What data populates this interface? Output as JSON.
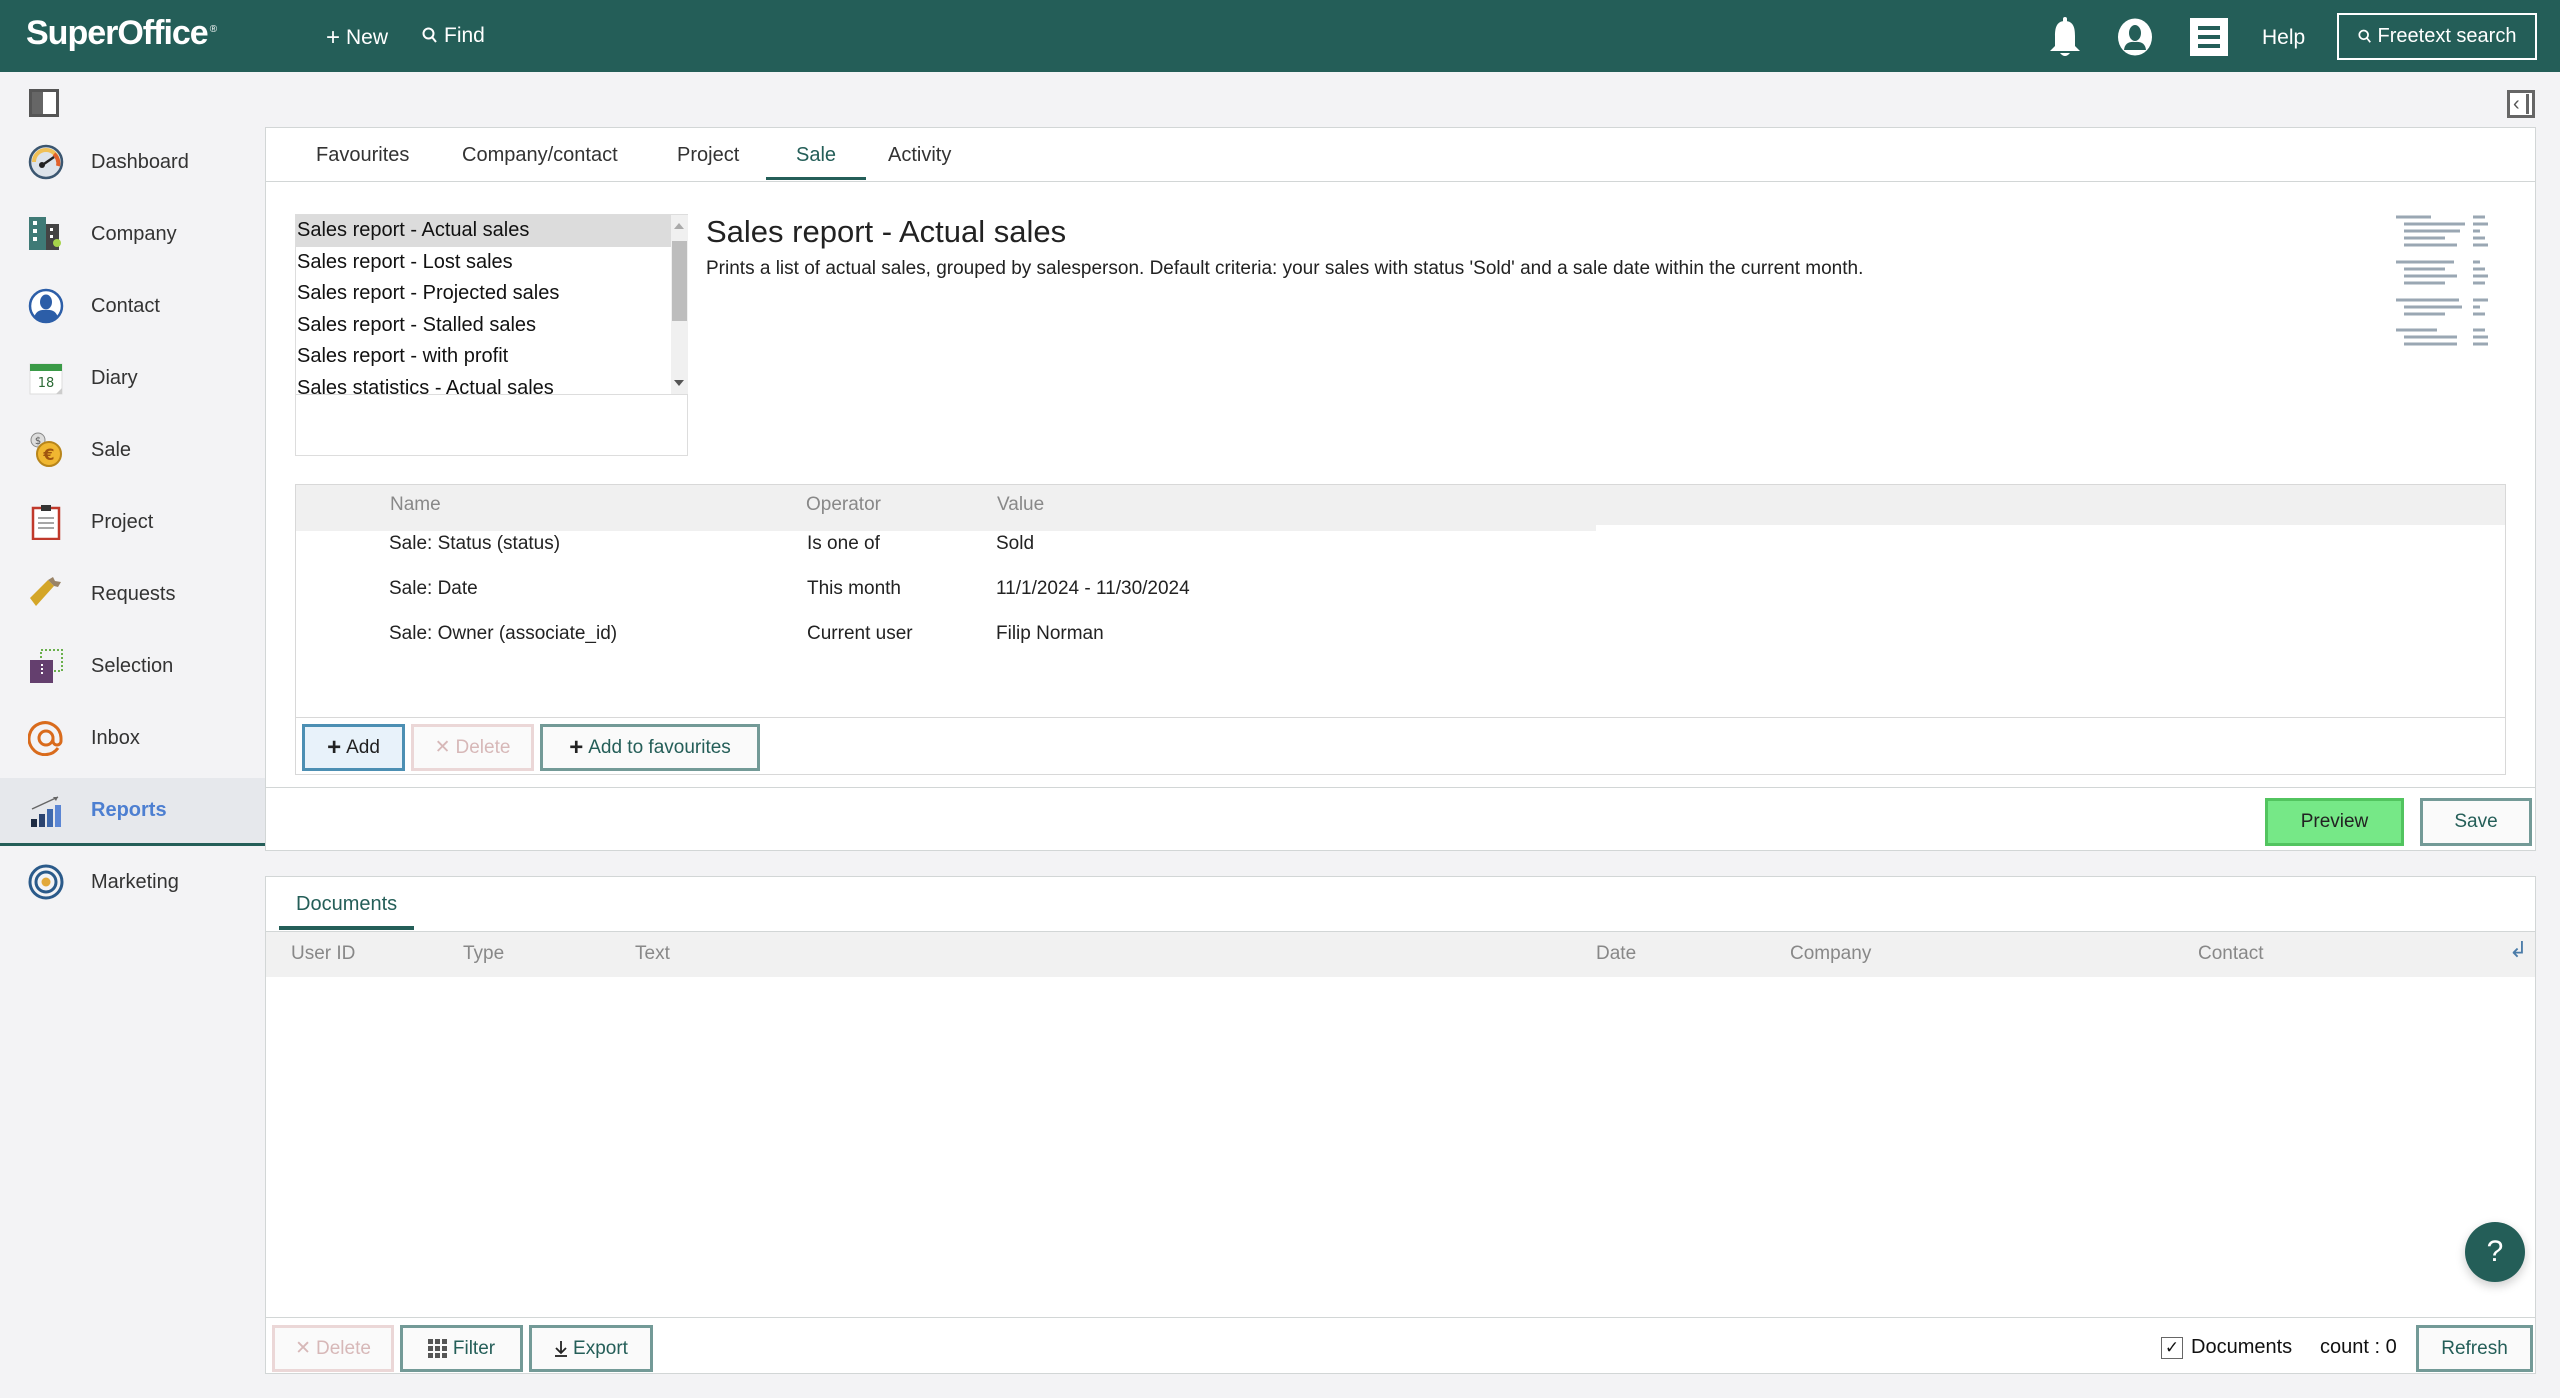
{
  "header": {
    "logo": "SuperOffice",
    "logo_mark": "®",
    "new_label": "New",
    "find_label": "Find",
    "help_label": "Help",
    "freetext_label": "Freetext search",
    "icons": [
      "plus-icon",
      "search-icon",
      "bell-icon",
      "user-icon",
      "menu-icon"
    ]
  },
  "sidebar": {
    "items": [
      {
        "label": "Dashboard",
        "icon": "dashboard-gauge-icon"
      },
      {
        "label": "Company",
        "icon": "company-building-icon"
      },
      {
        "label": "Contact",
        "icon": "contact-person-icon"
      },
      {
        "label": "Diary",
        "icon": "calendar-icon",
        "badge": "18"
      },
      {
        "label": "Sale",
        "icon": "coin-icon"
      },
      {
        "label": "Project",
        "icon": "clipboard-icon"
      },
      {
        "label": "Requests",
        "icon": "ticket-icon"
      },
      {
        "label": "Selection",
        "icon": "selection-icon"
      },
      {
        "label": "Inbox",
        "icon": "at-sign-icon"
      },
      {
        "label": "Reports",
        "icon": "bar-chart-icon",
        "active": true
      },
      {
        "label": "Marketing",
        "icon": "target-icon"
      }
    ]
  },
  "reports": {
    "tabs": [
      {
        "label": "Favourites"
      },
      {
        "label": "Company/contact"
      },
      {
        "label": "Project"
      },
      {
        "label": "Sale",
        "active": true
      },
      {
        "label": "Activity"
      }
    ],
    "list": [
      "Sales report - Actual sales",
      "Sales report - Lost sales",
      "Sales report - Projected sales",
      "Sales report - Stalled sales",
      "Sales report - with profit",
      "Sales statistics - Actual sales"
    ],
    "selected_index": 0,
    "title": "Sales report - Actual sales",
    "description": "Prints a list of actual sales, grouped by salesperson. Default criteria: your sales with status 'Sold' and a sale date within the current month.",
    "criteria": {
      "columns": [
        "Name",
        "Operator",
        "Value"
      ],
      "rows": [
        {
          "name": "Sale: Status (status)",
          "operator": "Is one of",
          "value": "Sold"
        },
        {
          "name": "Sale: Date",
          "operator": "This month",
          "value": "11/1/2024 - 11/30/2024"
        },
        {
          "name": "Sale: Owner (associate_id)",
          "operator": "Current user",
          "value": "Filip Norman"
        }
      ],
      "add_label": "Add",
      "delete_label": "Delete",
      "add_fav_label": "Add to favourites"
    },
    "preview_label": "Preview",
    "save_label": "Save"
  },
  "documents": {
    "tab_label": "Documents",
    "columns": [
      "User ID",
      "Type",
      "Text",
      "Date",
      "Company",
      "Contact"
    ],
    "rows": [],
    "delete_label": "Delete",
    "filter_label": "Filter",
    "export_label": "Export",
    "checkbox_label": "Documents",
    "checkbox_checked": true,
    "count_text": "count : 0",
    "refresh_label": "Refresh"
  },
  "help_fab": "?",
  "colors": {
    "brand": "#245e58",
    "active_nav": "#4d7fd1",
    "preview_button": "#76e887"
  }
}
